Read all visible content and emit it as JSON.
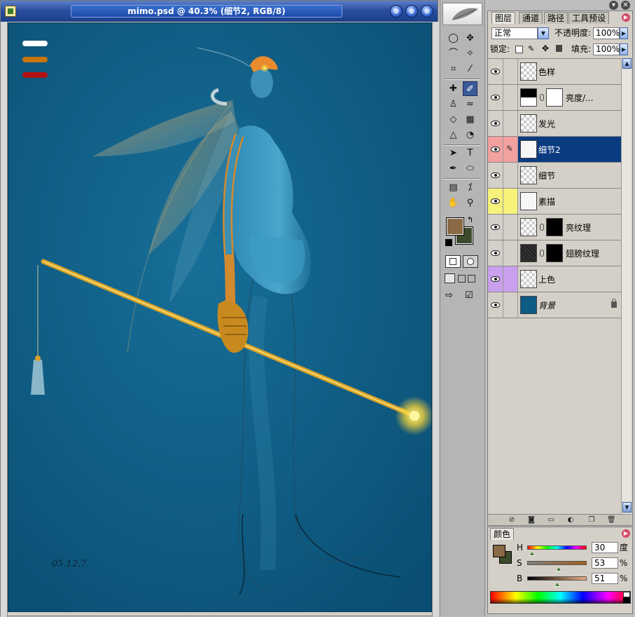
{
  "document": {
    "title": "mimo.psd @ 40.3% (细节2, RGB/8)",
    "canvas_date": "05.12.7."
  },
  "tools": {
    "rows": [
      [
        "◯",
        "✥"
      ],
      [
        "⌒",
        "✧"
      ],
      [
        "⌗",
        "⁄"
      ],
      [
        "✎",
        "✐"
      ],
      [
        "♙",
        "≈"
      ],
      [
        "◇",
        "▦"
      ],
      [
        "△",
        "◔"
      ],
      [
        "➤",
        "T"
      ],
      [
        "✒",
        "⬭"
      ],
      [
        "✎",
        "⁒"
      ],
      [
        "✋",
        "⚲"
      ]
    ]
  },
  "layers_panel": {
    "tabs": [
      "图层",
      "通道",
      "路径",
      "工具预设"
    ],
    "blend_mode": "正常",
    "opacity_label": "不透明度:",
    "opacity_value": "100%",
    "lock_label": "锁定:",
    "fill_label": "填充:",
    "fill_value": "100%",
    "layers": [
      {
        "name": "色样",
        "type": "transparent",
        "eye_color": "",
        "selected": false
      },
      {
        "name": "亮度/...",
        "type": "adjustment",
        "eye_color": "",
        "selected": false
      },
      {
        "name": "发光",
        "type": "transparent",
        "eye_color": "",
        "selected": false
      },
      {
        "name": "细节2",
        "type": "sketch",
        "eye_color": "#f3a0a0",
        "selected": true
      },
      {
        "name": "细节",
        "type": "transparent",
        "eye_color": "",
        "selected": false
      },
      {
        "name": "素描",
        "type": "sketch-white",
        "eye_color": "#f7f27a",
        "selected": false
      },
      {
        "name": "亮纹理",
        "type": "mask",
        "eye_color": "",
        "selected": false
      },
      {
        "name": "翅膀纹理",
        "type": "mask-noise",
        "eye_color": "",
        "selected": false
      },
      {
        "name": "上色",
        "type": "transparent",
        "eye_color": "#c9a0ee",
        "selected": false
      },
      {
        "name": "背景",
        "type": "background",
        "eye_color": "",
        "selected": false
      }
    ]
  },
  "color_panel": {
    "tab": "颜色",
    "h_label": "H",
    "h_value": "30",
    "h_unit": "度",
    "h_fraction": 0.083,
    "s_label": "S",
    "s_value": "53",
    "s_unit": "%",
    "s_fraction": 0.53,
    "b_label": "B",
    "b_value": "51",
    "b_unit": "%",
    "b_fraction": 0.51,
    "foreground": "#8a6a45",
    "background": "#3c4a2c"
  },
  "colors": {
    "canvas_bg": "#0e5c85",
    "selected_layer": "#0a3b80",
    "swatch_white": "#ffffff",
    "swatch_orange": "#c7750f",
    "swatch_red": "#b01010"
  }
}
